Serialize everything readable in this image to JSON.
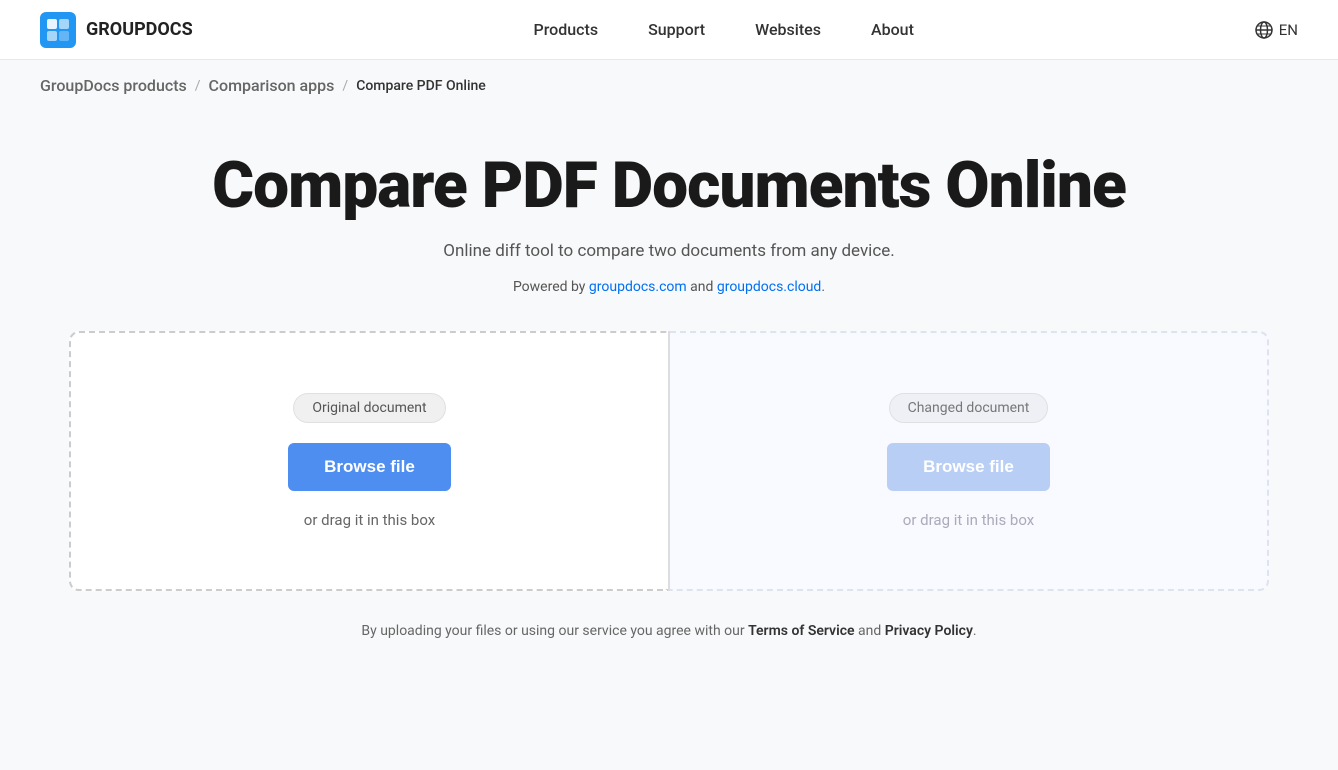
{
  "header": {
    "logo_text": "GROUPDOCS",
    "nav_items": [
      {
        "label": "Products",
        "href": "#"
      },
      {
        "label": "Support",
        "href": "#"
      },
      {
        "label": "Websites",
        "href": "#"
      },
      {
        "label": "About",
        "href": "#"
      }
    ],
    "language": "EN"
  },
  "breadcrumb": {
    "items": [
      {
        "label": "GroupDocs products",
        "href": "#"
      },
      {
        "label": "Comparison apps",
        "href": "#"
      },
      {
        "label": "Compare PDF Online",
        "href": null
      }
    ]
  },
  "main": {
    "title": "Compare PDF Documents Online",
    "subtitle": "Online diff tool to compare two documents from any device.",
    "powered_by_prefix": "Powered by ",
    "powered_by_link1_text": "groupdocs.com",
    "powered_by_link1_href": "#",
    "powered_by_and": " and ",
    "powered_by_link2_text": "groupdocs.cloud",
    "powered_by_link2_href": "#",
    "powered_by_suffix": "."
  },
  "drop_zones": {
    "zone1": {
      "label": "Original document",
      "browse_btn": "Browse file",
      "drag_text": "or drag it in this box"
    },
    "zone2": {
      "label": "Changed document",
      "browse_btn": "Browse file",
      "drag_text": "or drag it in this box"
    }
  },
  "footer_note": {
    "text_before": "By uploading your files or using our service you agree with our ",
    "tos_label": "Terms of Service",
    "and": " and ",
    "pp_label": "Privacy Policy",
    "text_after": "."
  }
}
